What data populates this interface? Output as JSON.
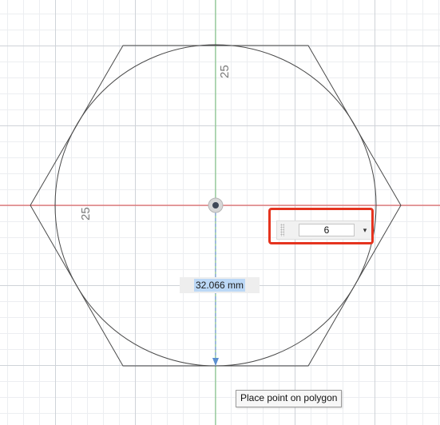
{
  "canvas": {
    "dimension_vertical": "25",
    "dimension_horizontal": "25"
  },
  "distance_input": {
    "value": "32.066 mm"
  },
  "sides_input": {
    "value": "6",
    "dropdown_glyph": "▾"
  },
  "tooltip": {
    "text": "Place point on polygon"
  },
  "colors": {
    "x_axis": "#e24b4b",
    "y_axis": "#79c47d",
    "sketch_line": "#4a4a4a",
    "highlight": "#e5341f",
    "dimension_arrow": "#5b8fd0"
  }
}
